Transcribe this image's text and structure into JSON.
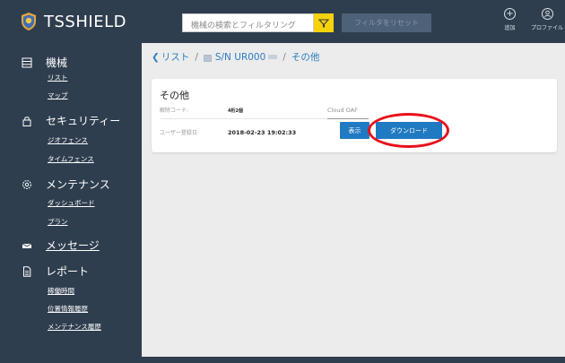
{
  "app": {
    "brand": "TSSHIELD"
  },
  "header": {
    "search_placeholder": "機械の検索とフィルタリング",
    "reset_filter": "フィルタをリセット",
    "add_label": "追加",
    "profile_label": "プロファイル"
  },
  "sidebar": {
    "machines": {
      "title": "機械",
      "items": [
        "リスト",
        "マップ"
      ]
    },
    "security": {
      "title": "セキュリティー",
      "items": [
        "ジオフェンス",
        "タイムフェンス"
      ]
    },
    "maintenance": {
      "title": "メンテナンス",
      "items": [
        "ダッシュボード",
        "プラン"
      ]
    },
    "messages": {
      "title": "メッセージ"
    },
    "reports": {
      "title": "レポート",
      "items": [
        "稼働時間",
        "位置情報履歴",
        "メンテナンス履歴"
      ]
    }
  },
  "breadcrumb": {
    "back": "リスト",
    "device": "S/N UR000",
    "current": "その他"
  },
  "card": {
    "title": "その他",
    "code_label": "解除コード:",
    "code_value": "4桁2個",
    "registered_label": "ユーザー登録日:",
    "registered_value": "2018-02-23 19:02:33",
    "cloud_label": "Cloud OAF",
    "view_button": "表示",
    "download_button": "ダウンロード"
  },
  "colors": {
    "sidebar_bg": "#2f3e4f",
    "accent": "#1f7ac1",
    "filter_yellow": "#f5d20b",
    "highlight_red": "#e8111b"
  }
}
